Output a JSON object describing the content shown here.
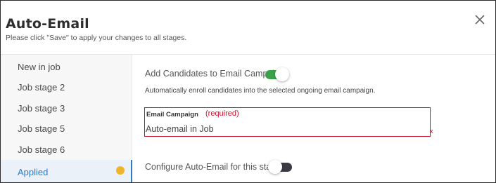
{
  "dialog": {
    "title": "Auto-Email",
    "subtitle": "Please click \"Save\" to apply your changes to all stages.",
    "close_icon": "close-icon"
  },
  "sidebar": {
    "items": [
      {
        "label": "New in job",
        "active": false
      },
      {
        "label": "Job stage 2",
        "active": false
      },
      {
        "label": "Job stage 3",
        "active": false
      },
      {
        "label": "Job stage 5",
        "active": false
      },
      {
        "label": "Job stage 6",
        "active": false
      },
      {
        "label": "Applied",
        "active": true,
        "status_color": "#f0b429"
      }
    ]
  },
  "main": {
    "add_to_campaign": {
      "label": "Add Candidates to Email Campaign",
      "enabled": true,
      "description": "Automatically enroll candidates into the selected ongoing email campaign."
    },
    "email_campaign": {
      "label": "Email Campaign",
      "required_text": "(required)",
      "value": "Auto-email in Job",
      "clear_glyph": "x"
    },
    "configure": {
      "label": "Configure Auto-Email for this stage",
      "enabled": false
    }
  },
  "colors": {
    "accent": "#2c7bc3",
    "toggle_on": "#3aa14a",
    "toggle_off": "#3b3b44",
    "error": "#c8102e",
    "status": "#f0b429"
  }
}
